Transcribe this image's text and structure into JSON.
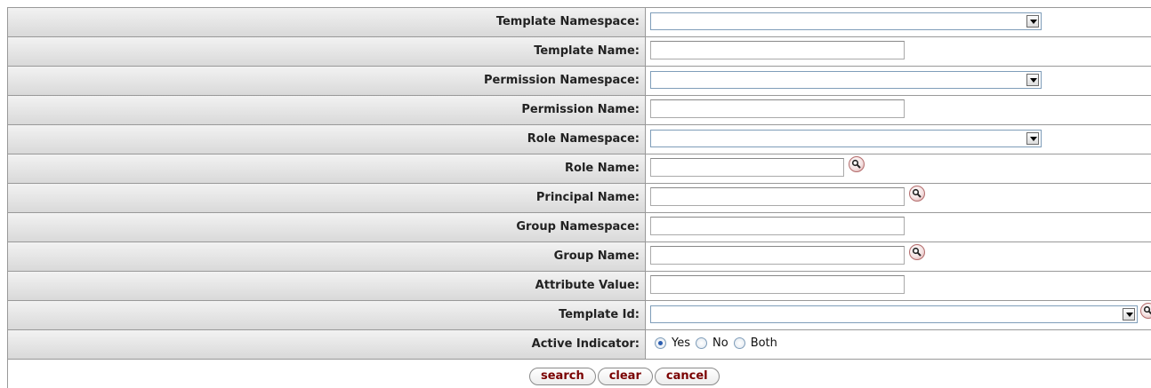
{
  "fields": [
    {
      "label": "Template Namespace:",
      "type": "select",
      "value": ""
    },
    {
      "label": "Template Name:",
      "type": "text",
      "value": ""
    },
    {
      "label": "Permission Namespace:",
      "type": "select",
      "value": ""
    },
    {
      "label": "Permission Name:",
      "type": "text",
      "value": ""
    },
    {
      "label": "Role Namespace:",
      "type": "select",
      "value": ""
    },
    {
      "label": "Role Name:",
      "type": "text-lookup",
      "value": "",
      "icon": "lookup-icon"
    },
    {
      "label": "Principal Name:",
      "type": "text-lookup",
      "value": "",
      "icon": "lookup-icon"
    },
    {
      "label": "Group Namespace:",
      "type": "text",
      "value": ""
    },
    {
      "label": "Group Name:",
      "type": "text-lookup",
      "value": "",
      "icon": "lookup-icon"
    },
    {
      "label": "Attribute Value:",
      "type": "text",
      "value": ""
    },
    {
      "label": "Template Id:",
      "type": "select-lookup",
      "value": "",
      "icon": "lookup-icon"
    },
    {
      "label": "Active Indicator:",
      "type": "radio",
      "options": [
        "Yes",
        "No",
        "Both"
      ],
      "selected": "Yes"
    }
  ],
  "buttons": {
    "search": "search",
    "clear": "clear",
    "cancel": "cancel"
  },
  "colors": {
    "button_text": "#7a0000",
    "label_bg": "#e3e3e3",
    "border": "#999999"
  }
}
